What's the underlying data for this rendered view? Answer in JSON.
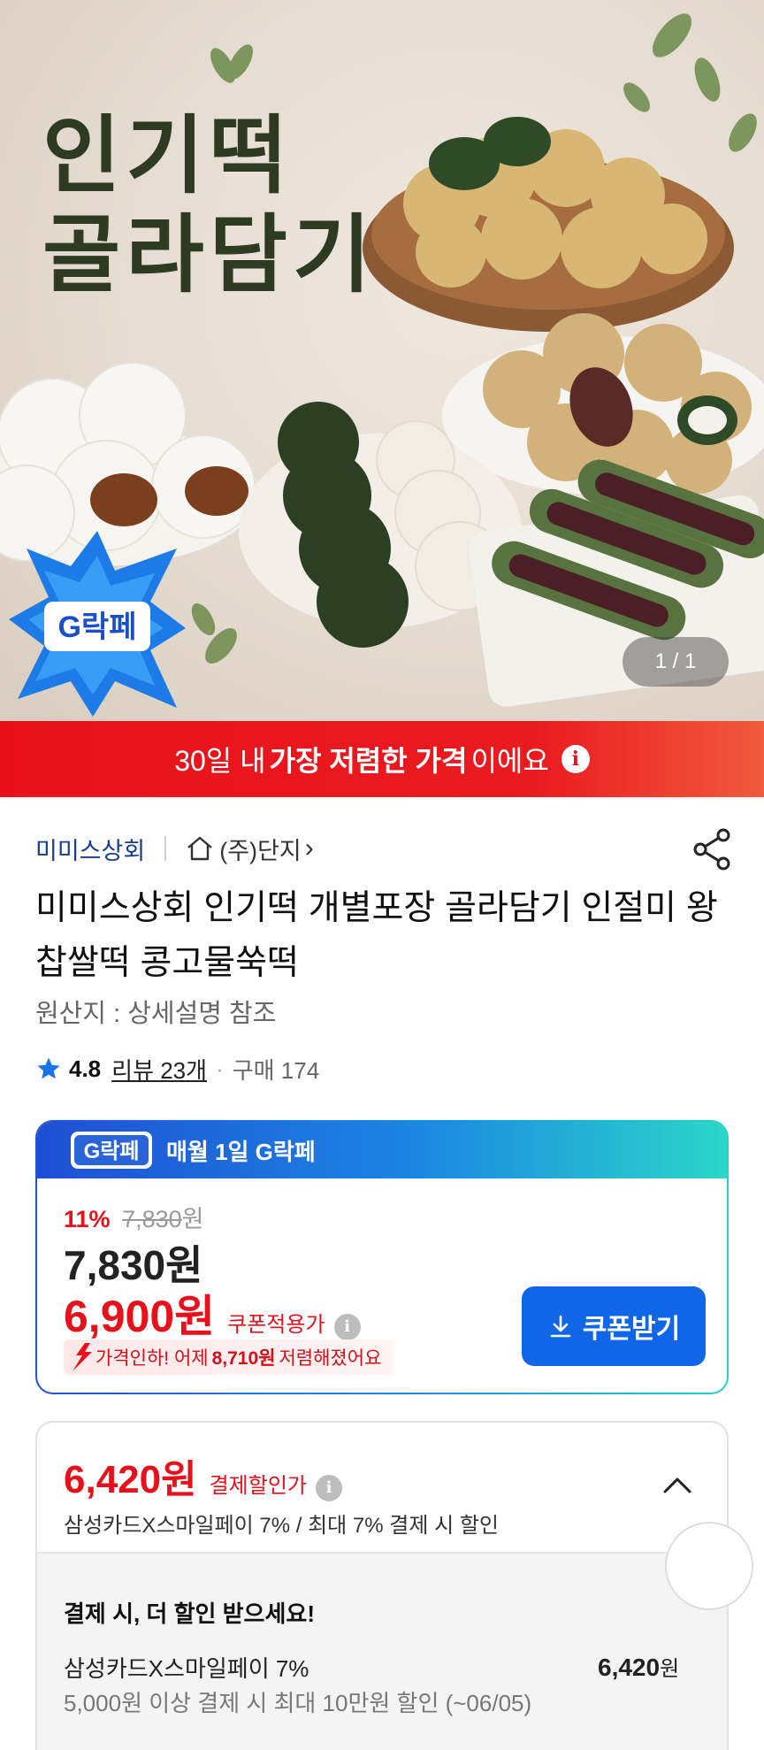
{
  "hero": {
    "title_line1": "인기떡",
    "title_line2": "골라담기",
    "counter": "1 / 1",
    "badge": "G락페"
  },
  "banner": {
    "prefix": "30일 내",
    "highlight": "가장 저렴한 가격",
    "suffix": "이에요",
    "info_glyph": "i"
  },
  "seller": {
    "name": "미미스상회",
    "store": "(주)단지",
    "store_arrow": "›"
  },
  "product": {
    "title": "미미스상회 인기떡 개별포장 골라담기 인절미 왕찹쌀떡 콩고물쑥떡",
    "origin": "원산지 : 상세설명 참조",
    "rating": "4.8",
    "reviews": "리뷰 23개",
    "purchase": "구매 174"
  },
  "coupon": {
    "header_badge": "G락페",
    "header_text": "매월 1일 G락페",
    "discount_pct": "11%",
    "original_price": "7,830",
    "original_unit": "원",
    "sale_price": "7,830원",
    "coupon_price": "6,900원",
    "coupon_label": "쿠폰적용가",
    "info_glyph": "i",
    "drop_prefix": "가격인하! 어제",
    "drop_amount": "8,710원",
    "drop_suffix": "저렴해졌어요",
    "button_label": "쿠폰받기"
  },
  "payment": {
    "price": "6,420원",
    "label": "결제할인가",
    "info_glyph": "i",
    "sub": "삼성카드X스마일페이 7% / 최대 7% 결제 시 할인",
    "detail_heading": "결제 시, 더 할인 받으세요!",
    "card_name": "삼성카드X스마일페이 7%",
    "card_desc": "5,000원 이상 결제 시 최대 10만원 할인 (~06/05)",
    "card_price": "6,420",
    "card_price_unit": "원"
  },
  "colors": {
    "brand_red": "#e8111b",
    "brand_blue": "#1166e8",
    "seller_blue": "#1a3c8f"
  },
  "icons": [
    "home-icon",
    "share-icon",
    "star-icon",
    "info-icon",
    "download-icon",
    "chevron-up-icon",
    "price-drop-arrow-icon"
  ]
}
